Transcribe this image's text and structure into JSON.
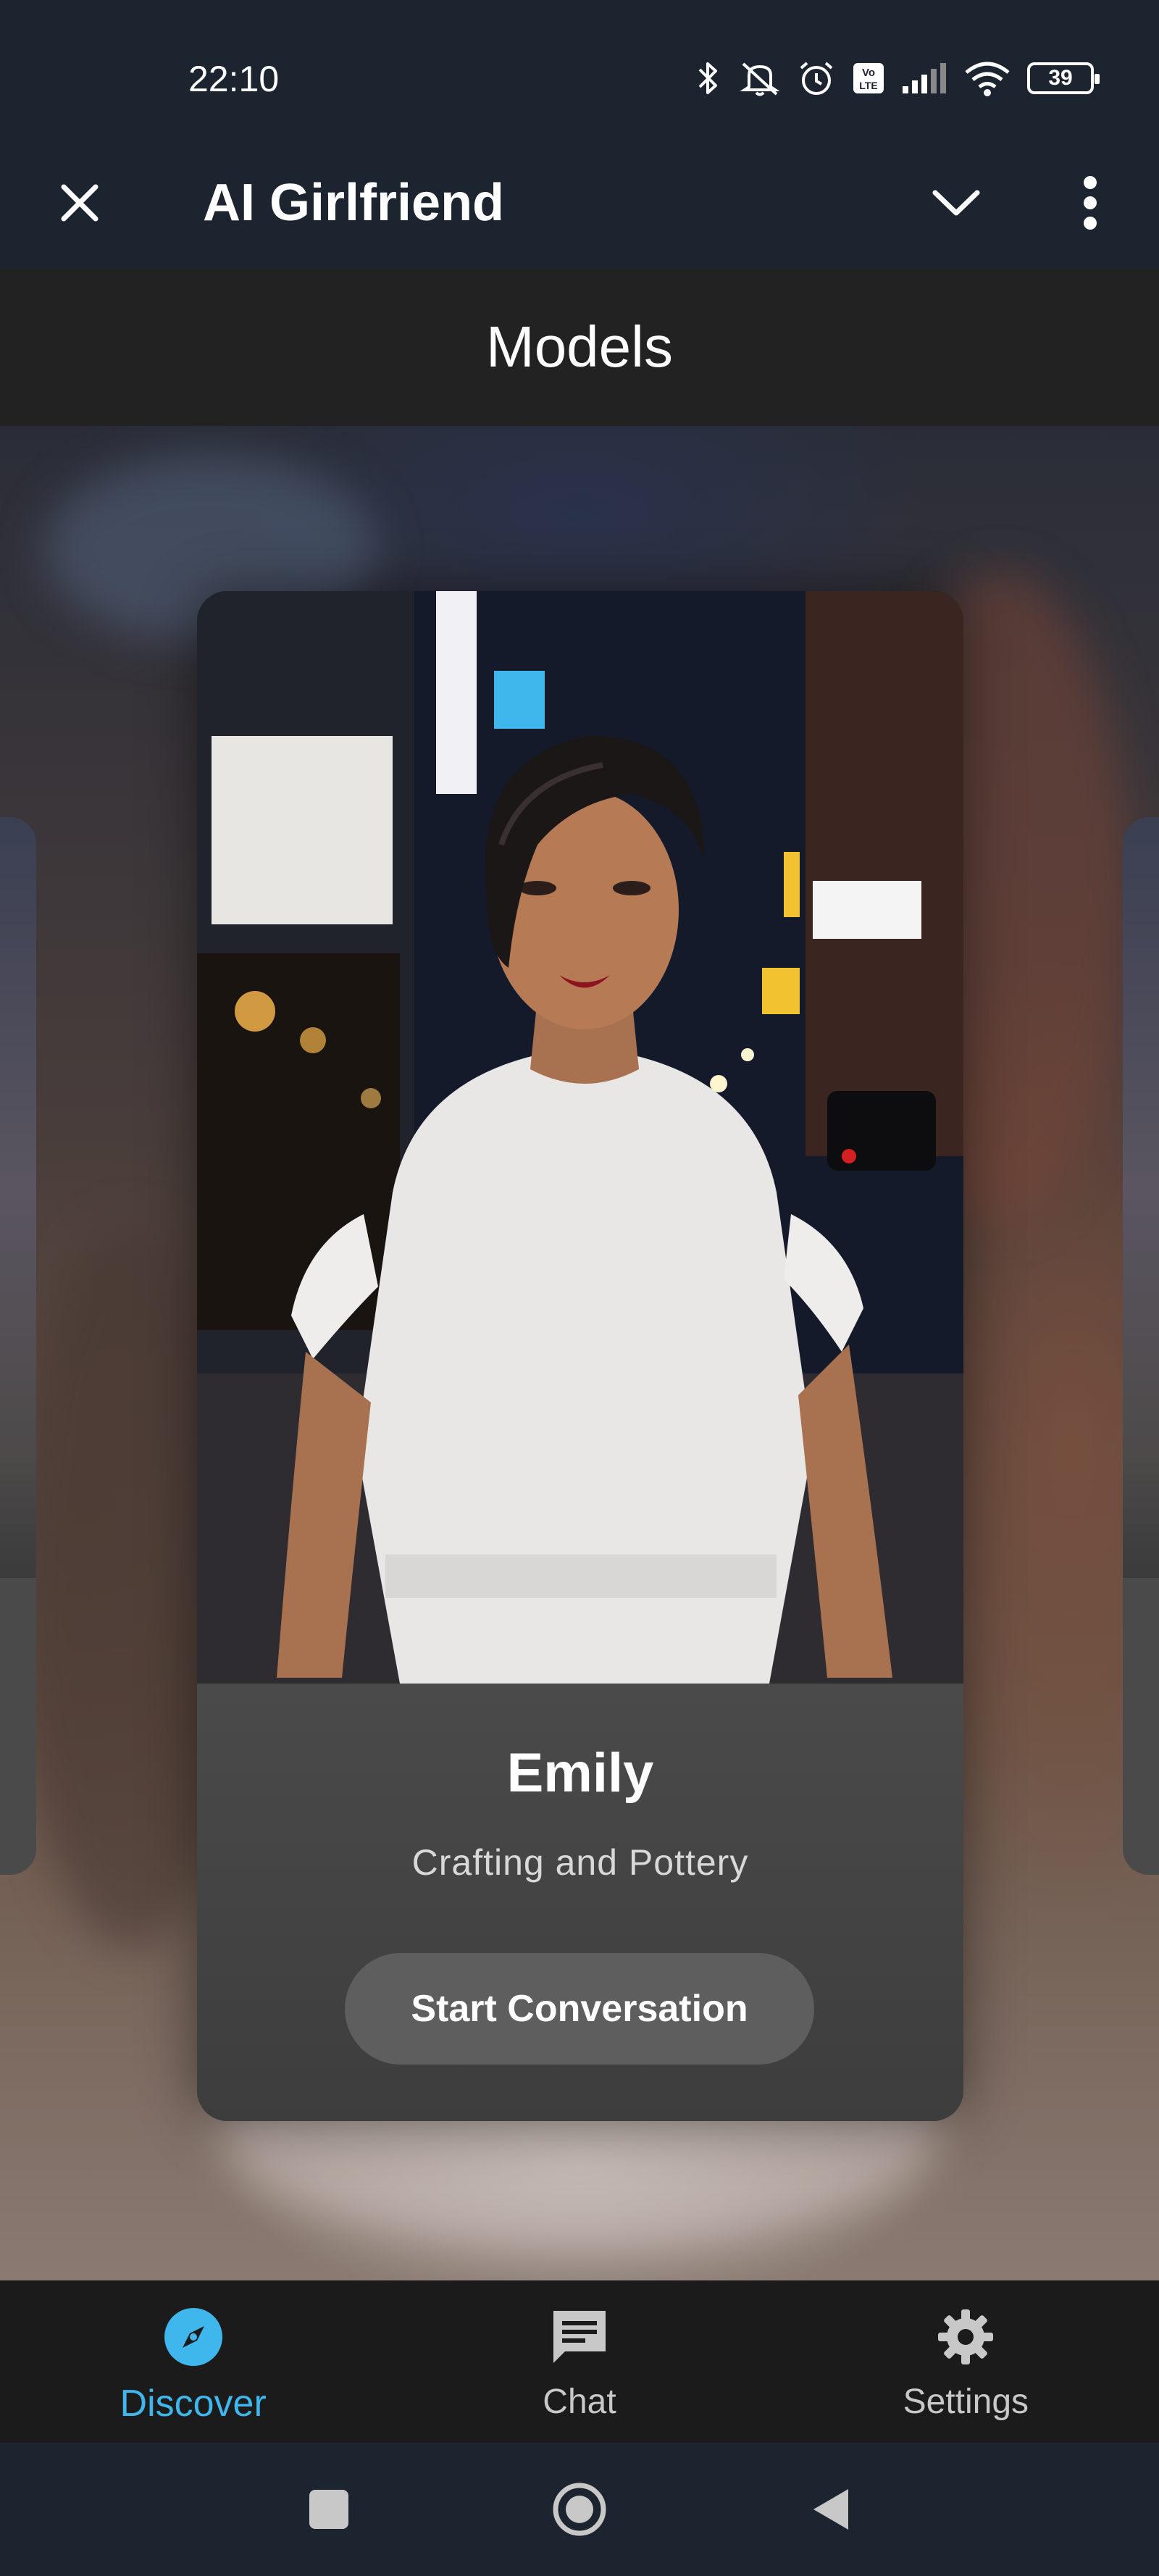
{
  "status_bar": {
    "time": "22:10",
    "battery": "39",
    "icons": [
      "bluetooth-icon",
      "mute-icon",
      "alarm-icon",
      "volte-icon",
      "signal-icon",
      "wifi-icon",
      "battery-icon"
    ]
  },
  "app_bar": {
    "title": "AI Girlfriend",
    "close_icon": "close-icon",
    "collapse_icon": "chevron-down-icon",
    "menu_icon": "more-vert-icon"
  },
  "section": {
    "title": "Models"
  },
  "carousel": {
    "current": {
      "name": "Emily",
      "tagline": "Crafting and Pottery",
      "button_label": "Start Conversation"
    }
  },
  "bottom_nav": {
    "items": [
      {
        "label": "Discover",
        "icon": "compass-icon",
        "active": true
      },
      {
        "label": "Chat",
        "icon": "chat-icon",
        "active": false
      },
      {
        "label": "Settings",
        "icon": "gear-icon",
        "active": false
      }
    ]
  },
  "system_nav": {
    "recents_icon": "square-icon",
    "home_icon": "circle-icon",
    "back_icon": "triangle-back-icon"
  },
  "colors": {
    "accent": "#3fb6ec",
    "status_bg": "#1c2430",
    "header_bg": "#222222",
    "nav_bg": "#1b1b1b",
    "button_bg": "#5e5e5e"
  }
}
